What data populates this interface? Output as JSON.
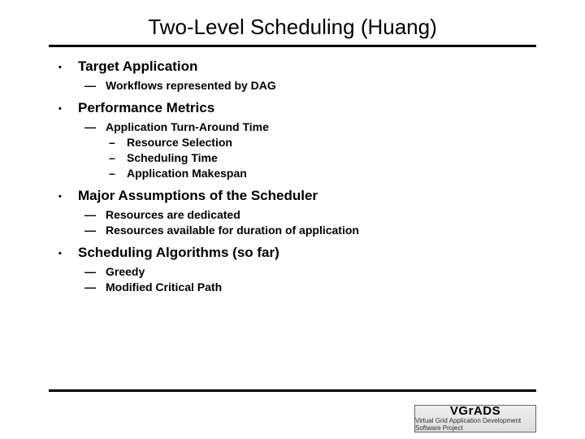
{
  "title": "Two-Level Scheduling (Huang)",
  "sections": [
    {
      "heading": "Target Application",
      "sub": [
        {
          "t": "Workflows represented by DAG"
        }
      ]
    },
    {
      "heading": "Performance Metrics",
      "sub": [
        {
          "t": "Application Turn-Around Time",
          "sub": [
            "Resource Selection",
            "Scheduling Time",
            "Application Makespan"
          ]
        }
      ]
    },
    {
      "heading": "Major Assumptions of the Scheduler",
      "sub": [
        {
          "t": "Resources are dedicated"
        },
        {
          "t": "Resources available for duration of application"
        }
      ]
    },
    {
      "heading": "Scheduling Algorithms (so far)",
      "sub": [
        {
          "t": "Greedy"
        },
        {
          "t": "Modified Critical Path"
        }
      ]
    }
  ],
  "logo": {
    "main": "VGrADS",
    "sub": "Virtual Grid Application Development Software Project"
  }
}
